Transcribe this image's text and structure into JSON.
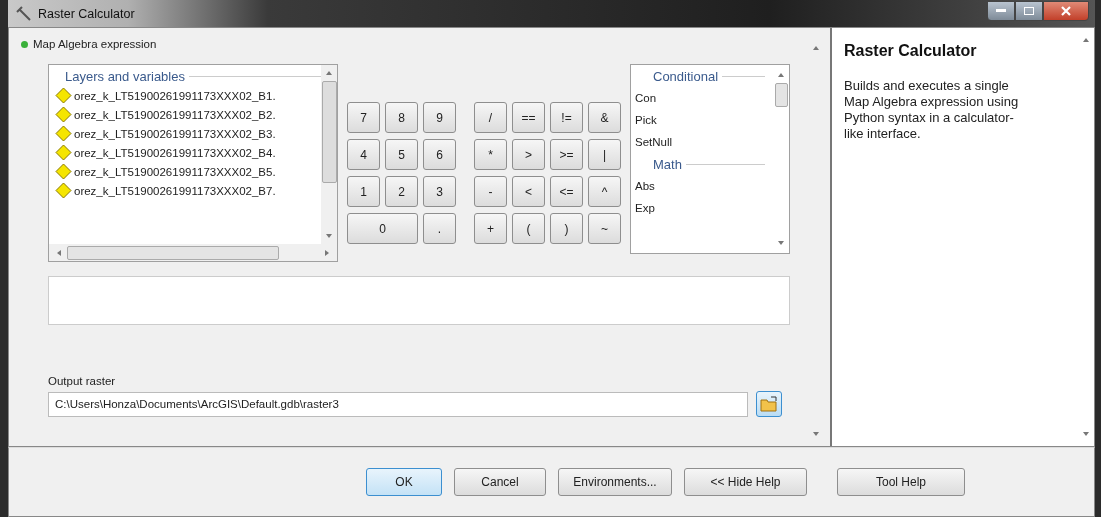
{
  "window": {
    "title": "Raster Calculator"
  },
  "expression": {
    "label": "Map Algebra expression"
  },
  "layers": {
    "heading": "Layers and variables",
    "items": [
      "orez_k_LT51900261991173XXX02_B1.",
      "orez_k_LT51900261991173XXX02_B2.",
      "orez_k_LT51900261991173XXX02_B3.",
      "orez_k_LT51900261991173XXX02_B4.",
      "orez_k_LT51900261991173XXX02_B5.",
      "orez_k_LT51900261991173XXX02_B7."
    ]
  },
  "keypad": [
    [
      "7",
      "8",
      "9",
      "/",
      "==",
      "!=",
      "&"
    ],
    [
      "4",
      "5",
      "6",
      "*",
      ">",
      ">=",
      "|"
    ],
    [
      "1",
      "2",
      "3",
      "-",
      "<",
      "<=",
      "^"
    ],
    [
      "0",
      ".",
      "+",
      "(",
      ")",
      "~"
    ]
  ],
  "functions": [
    {
      "heading": "Conditional",
      "items": [
        "Con",
        "Pick",
        "SetNull"
      ]
    },
    {
      "heading": "Math",
      "items": [
        "Abs",
        "Exp"
      ]
    }
  ],
  "output": {
    "label": "Output raster",
    "value": "C:\\Users\\Honza\\Documents\\ArcGIS\\Default.gdb\\raster3"
  },
  "buttons": [
    {
      "label": "OK",
      "default": true
    },
    {
      "label": "Cancel",
      "default": false
    },
    {
      "label": "Environments...",
      "default": false
    },
    {
      "label": "<< Hide Help",
      "default": false
    }
  ],
  "help": {
    "title": "Raster Calculator",
    "text": "Builds and executes a single Map Algebra expression using Python syntax in a calculator-like interface.",
    "button": "Tool Help"
  }
}
